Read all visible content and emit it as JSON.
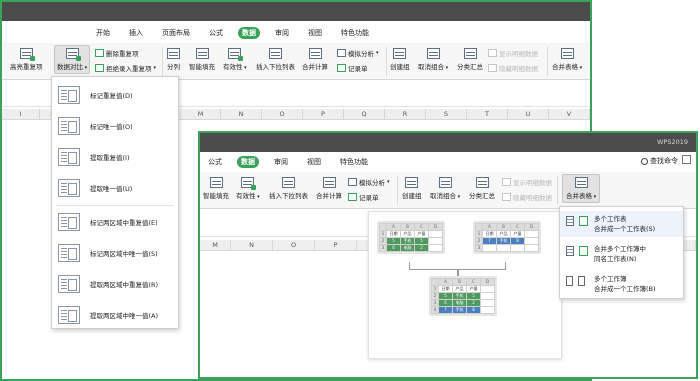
{
  "back_window": {
    "tabs": [
      "开始",
      "插入",
      "页面布局",
      "公式",
      "数据",
      "审阅",
      "视图",
      "特色功能"
    ],
    "active_tab": "数据",
    "ribbon": {
      "buttons": [
        "高亮重复项",
        "数据对比",
        "分列",
        "智能填充",
        "有效性",
        "插入下拉列表",
        "合并计算",
        "创建组",
        "取消组合",
        "分类汇总",
        "合并表格"
      ],
      "small_buttons": [
        "删除重复项",
        "拒绝录入重复项",
        "模拟分析",
        "记录单",
        "显示明细数据",
        "隐藏明细数据"
      ]
    },
    "columns": [
      "I",
      "M",
      "N",
      "O",
      "P",
      "Q",
      "R",
      "S",
      "T",
      "U",
      "V",
      "W"
    ],
    "menu_items": [
      "标记重复值(D)",
      "标记唯一值(O)",
      "提取重复值(I)",
      "提取唯一值(U)",
      "标记两区域中重复值(E)",
      "标记两区域中唯一值(S)",
      "提取两区域中重复值(R)",
      "提取两区域中唯一值(A)"
    ]
  },
  "front_window": {
    "brand": "WPS2019",
    "tabs": [
      "公式",
      "数据",
      "审阅",
      "视图",
      "特色功能"
    ],
    "active_tab": "数据",
    "search_label": "查找命令",
    "ribbon": {
      "buttons": [
        "智能填充",
        "有效性",
        "插入下拉列表",
        "合并计算",
        "创建组",
        "取消组合",
        "分类汇总",
        "合并表格"
      ],
      "small_buttons": [
        "模拟分析",
        "记录单",
        "显示明细数据",
        "隐藏明细数据"
      ]
    },
    "columns": [
      "M",
      "N",
      "O",
      "P",
      "Q",
      "R",
      "S",
      "T",
      "U",
      "V",
      "W",
      "X"
    ],
    "illustration": {
      "col_headers": [
        "A",
        "B",
        "C",
        "D"
      ],
      "header_row": [
        "日期",
        "产品",
        "产量"
      ],
      "sheet1_rows": [
        [
          "5",
          "手机",
          "5"
        ],
        [
          "6",
          "电脑",
          "2"
        ]
      ],
      "sheet2_rows": [
        [
          "7",
          "手机",
          "8"
        ]
      ],
      "merged_rows": [
        [
          "5",
          "手机",
          "5"
        ],
        [
          "6",
          "电脑",
          "2"
        ],
        [
          "7",
          "手机",
          "8"
        ]
      ],
      "row_numbers": [
        "1",
        "2",
        "3",
        "4"
      ]
    },
    "submenu": [
      {
        "line1": "多个工作表",
        "line2": "合并成一个工作表(S)"
      },
      {
        "line1": "合并多个工作簿中",
        "line2": "同名工作表(N)"
      },
      {
        "line1": "多个工作簿",
        "line2": "合并成一个工作簿(B)"
      }
    ]
  },
  "colors": {
    "accent": "#3aa35a",
    "titlebar": "#4b4b4b",
    "blue_cell": "#4a7fc0"
  }
}
